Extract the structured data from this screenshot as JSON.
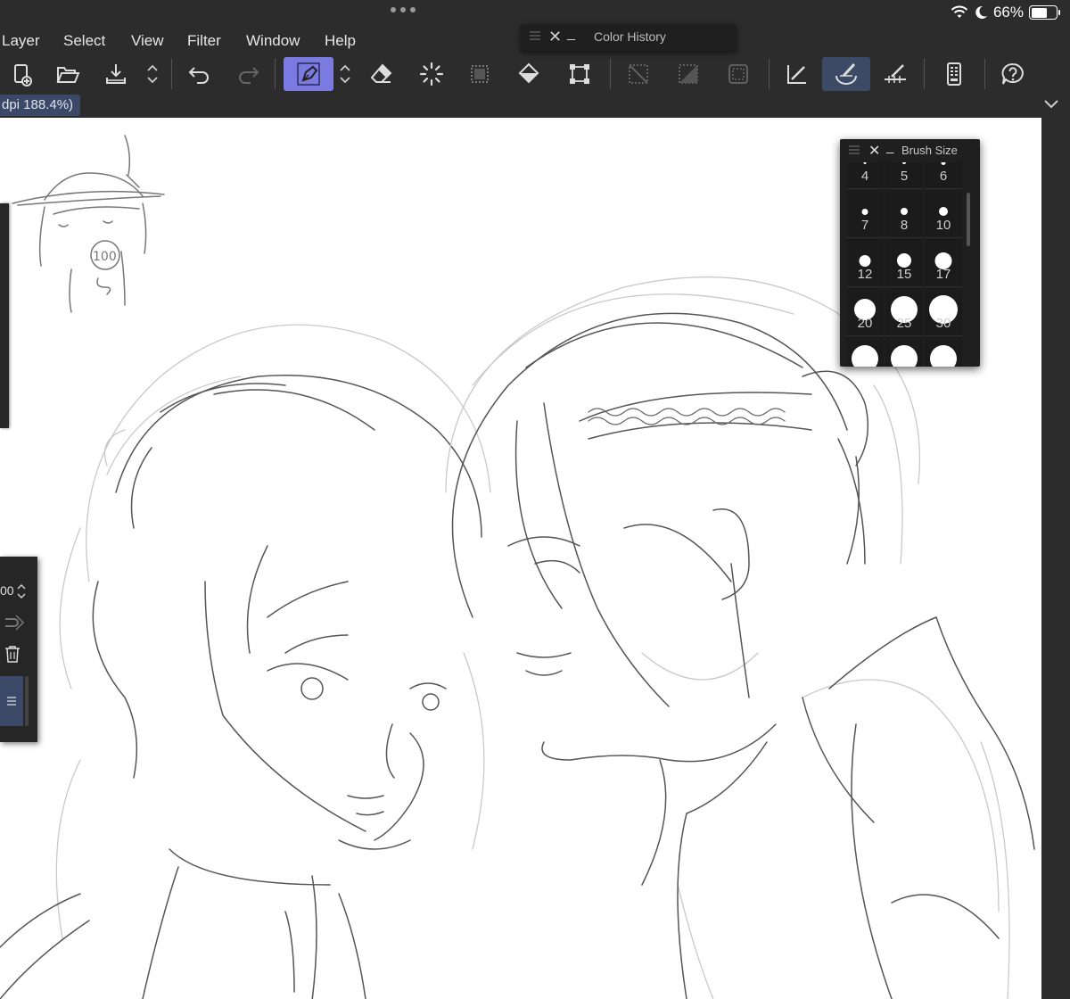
{
  "status_bar": {
    "battery_percent": "66%",
    "battery_level": 0.66
  },
  "menu": {
    "items": [
      "Layer",
      "Select",
      "View",
      "Filter",
      "Window",
      "Help"
    ]
  },
  "color_history_palette": {
    "title": "Color History"
  },
  "toolbar": {
    "tools": [
      "new-canvas-icon",
      "open-icon",
      "save-icon",
      "chevron-updown-icon",
      "undo-icon",
      "redo-icon",
      "pen-tool-icon",
      "chevron-updown-icon",
      "eraser-icon",
      "selection-loading-icon",
      "select-dotted-icon",
      "fill-bucket-icon",
      "transform-icon",
      "clear-selection-icon",
      "invert-selection-icon",
      "selection-border-icon",
      "ruler-brush-icon",
      "brush-stroke-icon",
      "snap-ruler-icon",
      "device-panel-icon",
      "help-icon"
    ],
    "active_tool": "pen-tool-icon",
    "active_stroke_tool": "brush-stroke-icon",
    "accent_color": "#7a7ae0"
  },
  "document_tab": {
    "label": "dpi 188.4%)"
  },
  "left_panel": {
    "value": "00"
  },
  "brush_size_palette": {
    "title": "Brush Size",
    "sizes": [
      {
        "value": "4",
        "dot": 3
      },
      {
        "value": "5",
        "dot": 4
      },
      {
        "value": "6",
        "dot": 5
      },
      {
        "value": "7",
        "dot": 7
      },
      {
        "value": "8",
        "dot": 8
      },
      {
        "value": "10",
        "dot": 10
      },
      {
        "value": "12",
        "dot": 13
      },
      {
        "value": "15",
        "dot": 16
      },
      {
        "value": "17",
        "dot": 19
      },
      {
        "value": "20",
        "dot": 24
      },
      {
        "value": "25",
        "dot": 30
      },
      {
        "value": "30",
        "dot": 32
      },
      {
        "value": "",
        "dot": 30
      },
      {
        "value": "",
        "dot": 30
      },
      {
        "value": "",
        "dot": 30
      }
    ]
  },
  "canvas": {
    "sketch_badge_text": "100"
  }
}
